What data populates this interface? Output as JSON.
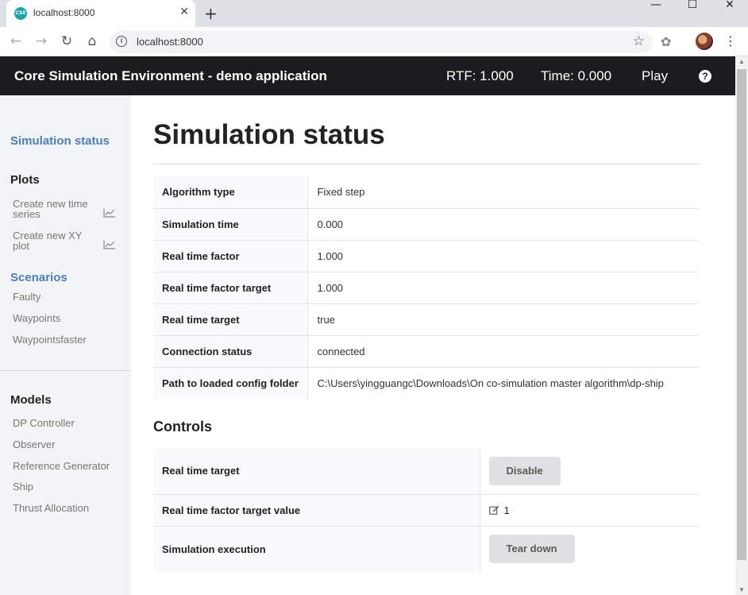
{
  "browser": {
    "tab_favicon": "CSE",
    "tab_title": "localhost:8000",
    "tab_close": "✕",
    "new_tab": "+",
    "url": "localhost:8000",
    "info_icon": "i",
    "win_min": "—",
    "win_max": "☐",
    "win_close": "✕"
  },
  "navbar": {
    "brand": "Core Simulation Environment - demo application",
    "rtf": "RTF: 1.000",
    "time": "Time: 0.000",
    "play": "Play",
    "help": "?"
  },
  "sidebar": {
    "active": "Simulation status",
    "plots_header": "Plots",
    "plot_items": [
      "Create new time series",
      "Create new XY plot"
    ],
    "scenarios_header": "Scenarios",
    "scenarios": [
      "Faulty",
      "Waypoints",
      "Waypointsfaster"
    ],
    "models_header": "Models",
    "models": [
      "DP Controller",
      "Observer",
      "Reference Generator",
      "Ship",
      "Thrust Allocation"
    ]
  },
  "main": {
    "title": "Simulation status",
    "status_rows": [
      {
        "key": "Algorithm type",
        "value": "Fixed step"
      },
      {
        "key": "Simulation time",
        "value": "0.000"
      },
      {
        "key": "Real time factor",
        "value": "1.000"
      },
      {
        "key": "Real time factor target",
        "value": "1.000"
      },
      {
        "key": "Real time target",
        "value": "true"
      },
      {
        "key": "Connection status",
        "value": "connected"
      },
      {
        "key": "Path to loaded config folder",
        "value": "C:\\Users\\yingguangc\\Downloads\\On co-simulation master algorithm\\dp-ship"
      }
    ],
    "controls_title": "Controls",
    "controls": {
      "realtime_target_label": "Real time target",
      "disable_button": "Disable",
      "rtf_target_label": "Real time factor target value",
      "rtf_target_value": "1",
      "execution_label": "Simulation execution",
      "teardown_button": "Tear down"
    }
  },
  "colors": {
    "navbar_bg": "#1b1c1d",
    "accent_blue": "#4a7fbc",
    "sidebar_bg": "#f3f4f5",
    "button_bg": "#e0e1e2"
  }
}
